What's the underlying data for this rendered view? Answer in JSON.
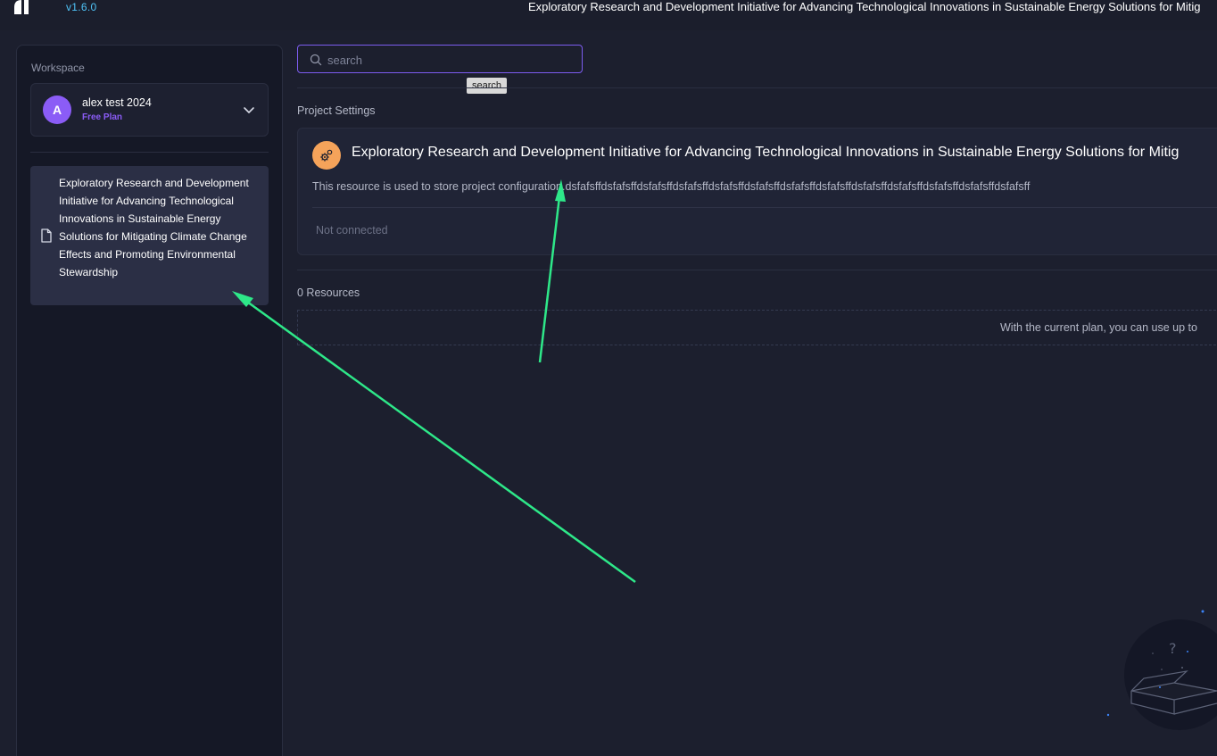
{
  "header": {
    "version": "v1.6.0",
    "title": "Exploratory Research and Development Initiative for Advancing Technological Innovations in Sustainable Energy Solutions for Mitig"
  },
  "sidebar": {
    "workspace_label": "Workspace",
    "workspace": {
      "avatar_letter": "A",
      "name": "alex test 2024",
      "plan": "Free Plan"
    },
    "items": [
      {
        "label": "Exploratory Research and Development Initiative for Advancing Technological Innovations in Sustainable Energy Solutions for Mitigating Climate Change Effects and Promoting Environmental Stewardship",
        "icon": "document-icon"
      }
    ]
  },
  "search": {
    "placeholder": "search",
    "tooltip": "search"
  },
  "main": {
    "project_settings_label": "Project Settings",
    "settings_card": {
      "title": "Exploratory Research and Development Initiative for Advancing Technological Innovations in Sustainable Energy Solutions for Mitig",
      "description": "This resource is used to store project configuration.dsfafsffdsfafsffdsfafsffdsfafsffdsfafsffdsfafsffdsfafsffdsfafsffdsfafsffdsfafsffdsfafsffdsfafsffdsfafsff",
      "status": "Not connected",
      "icon": "settings-gears-icon"
    },
    "resources_label": "0 Resources",
    "plan_note": "With the current plan, you can use up to"
  },
  "colors": {
    "accent": "#7c5cf0",
    "version": "#4fc3f7",
    "avatar": "#8b5cf6",
    "settings_icon_bg": "#f5a35a",
    "annotation_arrow": "#2ee889"
  }
}
